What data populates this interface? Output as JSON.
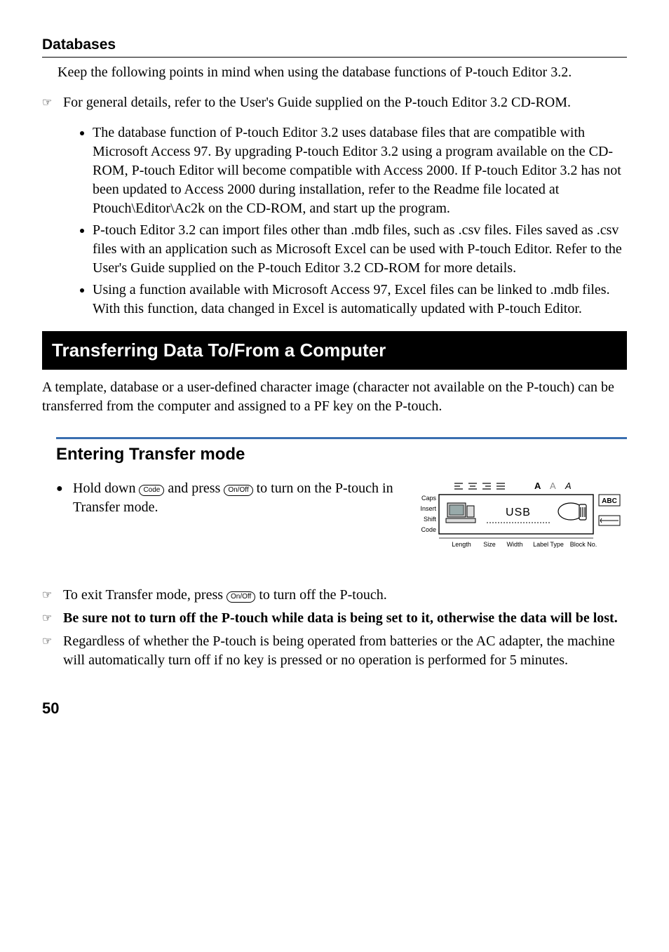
{
  "sections": {
    "databases": {
      "heading": "Databases",
      "intro": "Keep the following points in mind when using the database functions of P-touch Editor 3.2.",
      "note": "For general details, refer to the User's Guide supplied on the P-touch Editor 3.2 CD-ROM.",
      "bullets": [
        "The database function of P-touch Editor 3.2 uses database files that are compatible with Microsoft Access 97. By upgrading P-touch Editor 3.2 using a program available on the CD-ROM, P-touch Editor will become compatible with Access 2000. If P-touch Editor 3.2 has not been updated to Access 2000 during installation, refer to the Readme file located at Ptouch\\Editor\\Ac2k on the CD-ROM, and start up the program.",
        "P-touch Editor 3.2 can import files other than .mdb files, such as .csv files. Files saved as .csv files with an application such as Microsoft Excel can be used with P-touch Editor. Refer to the User's Guide supplied on the P-touch Editor 3.2 CD-ROM for more details.",
        "Using a function available with Microsoft Access 97, Excel files can be linked to .mdb files. With this function, data changed in Excel is automatically updated with P-touch Editor."
      ]
    },
    "transfer": {
      "banner": "Transferring Data To/From a Computer",
      "intro": "A template, database or a user-defined character image (character not available on the P-touch) can be transferred from the computer and assigned to a PF key on the P-touch."
    },
    "entering": {
      "heading": "Entering Transfer mode",
      "step_pre": "Hold down ",
      "step_mid": " and press ",
      "step_post": " to turn on the P-touch in Transfer mode.",
      "key_code": "Code",
      "key_onoff": "On/Off",
      "lcd": {
        "caps": "Caps",
        "insert": "Insert",
        "shift": "Shift",
        "code": "Code",
        "usb": "USB",
        "abc": "ABC",
        "bottom": {
          "length": "Length",
          "size": "Size",
          "width": "Width",
          "labeltype": "Label Type",
          "blockno": "Block No."
        }
      },
      "notes": {
        "n1_pre": "To exit Transfer mode, press ",
        "n1_post": " to turn off the P-touch.",
        "n2": "Be sure not to turn off the P-touch while data is being set to it, otherwise the data will be lost.",
        "n3": "Regardless of whether the P-touch is being operated from batteries or the AC adapter, the machine will automatically turn off if no key is pressed or no operation is performed for 5 minutes."
      }
    }
  },
  "page_number": "50"
}
